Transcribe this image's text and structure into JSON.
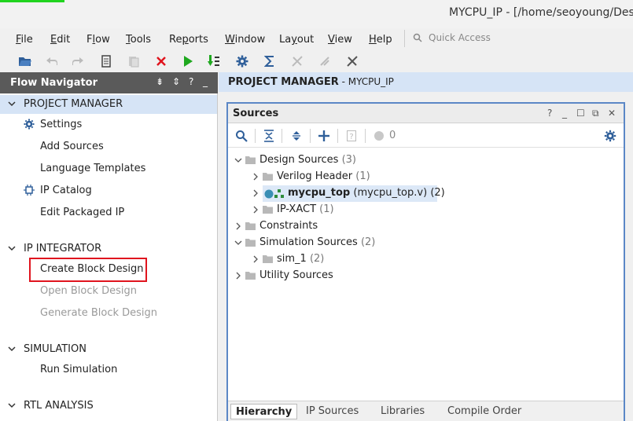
{
  "window": {
    "title": "MYCPU_IP - [/home/seoyoung/Desk"
  },
  "menu": {
    "items": [
      {
        "label": "File",
        "underline": "F",
        "rest": "ile"
      },
      {
        "label": "Edit",
        "underline": "E",
        "rest": "dit"
      },
      {
        "label": "Flow",
        "pre": "F",
        "underline": "l",
        "rest": "ow"
      },
      {
        "label": "Tools",
        "underline": "T",
        "rest": "ools"
      },
      {
        "label": "Reports",
        "pre": "Re",
        "underline": "p",
        "rest": "orts"
      },
      {
        "label": "Window",
        "underline": "W",
        "rest": "indow"
      },
      {
        "label": "Layout",
        "pre": "La",
        "underline": "y",
        "rest": "out"
      },
      {
        "label": "View",
        "underline": "V",
        "rest": "iew"
      },
      {
        "label": "Help",
        "underline": "H",
        "rest": "elp"
      }
    ],
    "quick_access_placeholder": "Quick Access"
  },
  "toolbar": {
    "icons": [
      "open-project-icon",
      "undo-icon",
      "redo-icon",
      "copy-icon",
      "paste-icon",
      "delete-icon",
      "run-icon",
      "run-step-icon",
      "settings-icon",
      "sigma-icon",
      "tool-disabled-1-icon",
      "tool-disabled-2-icon",
      "tool-disabled-3-icon"
    ]
  },
  "flow_navigator": {
    "title": "Flow Navigator",
    "sections": {
      "project_manager": {
        "label": "PROJECT MANAGER",
        "items": {
          "settings": "Settings",
          "add_sources": "Add Sources",
          "language_templates": "Language Templates",
          "ip_catalog": "IP Catalog",
          "edit_packaged_ip": "Edit Packaged IP"
        }
      },
      "ip_integrator": {
        "label": "IP INTEGRATOR",
        "items": {
          "create_block_design": "Create Block Design",
          "open_block_design": "Open Block Design",
          "generate_block_design": "Generate Block Design"
        }
      },
      "simulation": {
        "label": "SIMULATION",
        "items": {
          "run_simulation": "Run Simulation"
        }
      },
      "rtl_analysis": {
        "label": "RTL ANALYSIS"
      }
    }
  },
  "project_manager_header": {
    "title": "PROJECT MANAGER",
    "separator": " - ",
    "project": "MYCPU_IP"
  },
  "sources": {
    "title": "Sources",
    "toolbar_count": "0",
    "tree": {
      "design_sources": {
        "label": "Design Sources",
        "count": "(3)"
      },
      "verilog_header": {
        "label": "Verilog Header",
        "count": "(1)"
      },
      "mycpu_top": {
        "label": "mycpu_top",
        "file": "(mycpu_top.v)",
        "count": "(2)"
      },
      "ip_xact": {
        "label": "IP-XACT",
        "count": "(1)"
      },
      "constraints": {
        "label": "Constraints"
      },
      "simulation_sources": {
        "label": "Simulation Sources",
        "count": "(2)"
      },
      "sim_1": {
        "label": "sim_1",
        "count": "(2)"
      },
      "utility_sources": {
        "label": "Utility Sources"
      }
    },
    "tabs": {
      "hierarchy": "Hierarchy",
      "ip_sources": "IP Sources",
      "libraries": "Libraries",
      "compile_order": "Compile Order"
    }
  },
  "colors": {
    "accent_green": "#21d41f",
    "nav_header": "#5a5a5a",
    "selection_blue": "#d6e4f6",
    "panel_border": "#5b87c6",
    "highlight_red": "#e0141e"
  }
}
